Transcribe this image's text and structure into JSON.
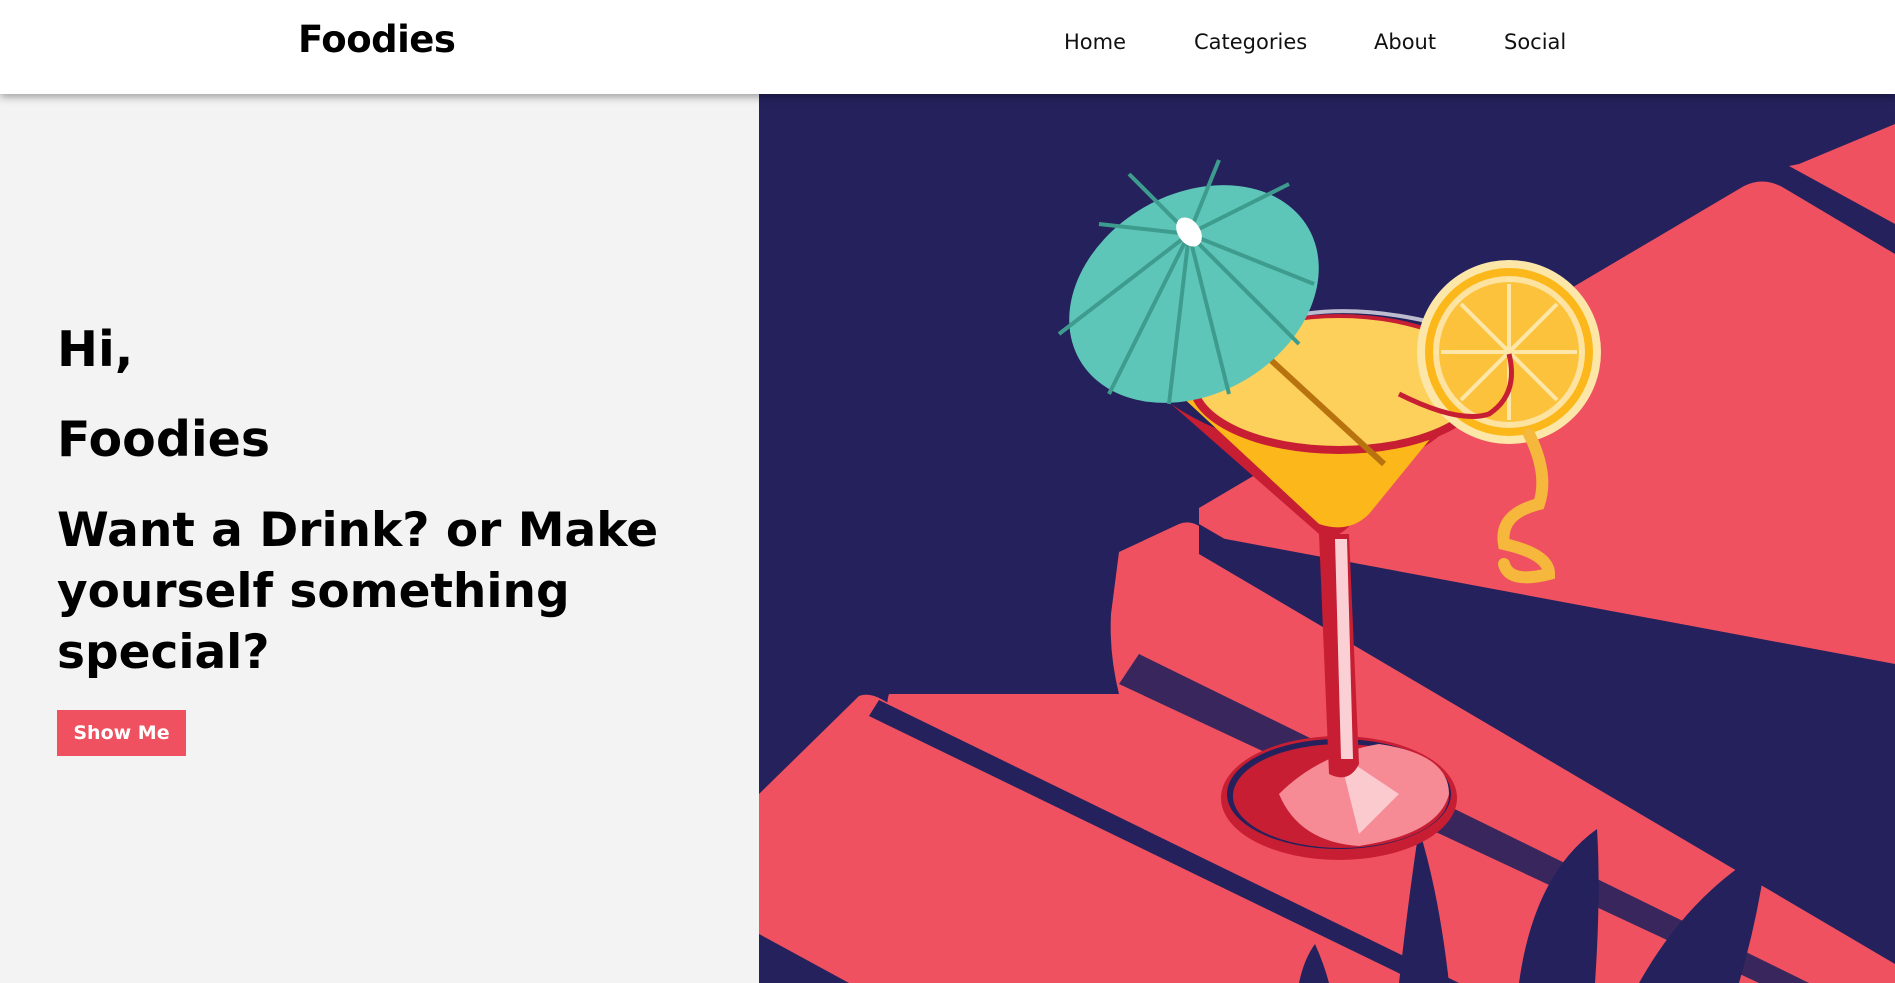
{
  "navbar": {
    "brand": "Foodies",
    "links": [
      {
        "label": "Home"
      },
      {
        "label": "Categories"
      },
      {
        "label": "About"
      },
      {
        "label": "Social"
      }
    ]
  },
  "hero": {
    "greeting": "Hi,",
    "name": "Foodies",
    "tagline": "Want a Drink? or Make yourself something special?",
    "cta_label": "Show Me"
  },
  "colors": {
    "accent": "#ef5160",
    "navy": "#24215c",
    "background": "#f3f3f3",
    "umbrella": "#5ec6b8",
    "orange": "#fcb71a"
  },
  "icons": {
    "illustration": "cocktail-illustration-icon"
  }
}
